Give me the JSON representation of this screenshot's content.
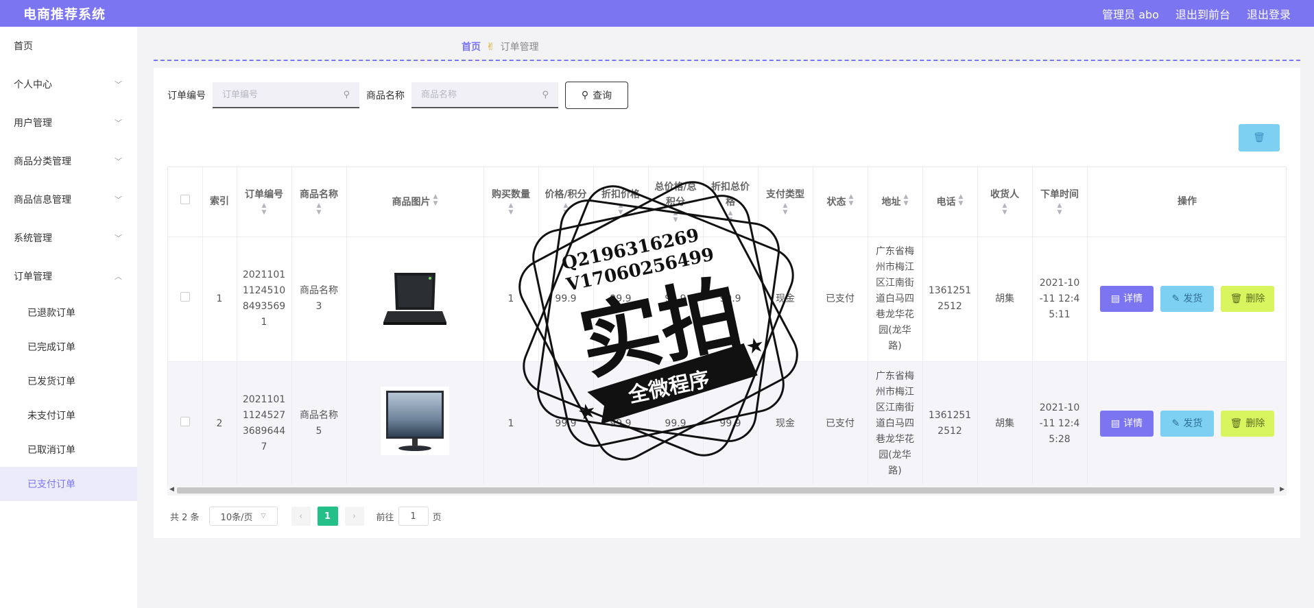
{
  "header": {
    "brand": "电商推荐系统",
    "admin": "管理员 abo",
    "to_front": "退出到前台",
    "logout": "退出登录"
  },
  "sidebar": {
    "items": [
      {
        "label": "首页"
      },
      {
        "label": "个人中心"
      },
      {
        "label": "用户管理"
      },
      {
        "label": "商品分类管理"
      },
      {
        "label": "商品信息管理"
      },
      {
        "label": "系统管理"
      },
      {
        "label": "订单管理"
      }
    ],
    "order_sub": [
      {
        "label": "已退款订单"
      },
      {
        "label": "已完成订单"
      },
      {
        "label": "已发货订单"
      },
      {
        "label": "未支付订单"
      },
      {
        "label": "已取消订单"
      },
      {
        "label": "已支付订单"
      }
    ]
  },
  "breadcrumb": {
    "home": "首页",
    "current": "订单管理"
  },
  "search": {
    "order_label": "订单编号",
    "order_placeholder": "订单编号",
    "product_label": "商品名称",
    "product_placeholder": "商品名称",
    "query": "查询"
  },
  "table": {
    "headers": {
      "index": "索引",
      "order_no": "订单编号",
      "product_name": "商品名称",
      "product_img": "商品图片",
      "qty": "购买数量",
      "price": "价格/积分",
      "discount_price": "折扣价格",
      "total": "总价格/总积分",
      "discount_total": "折扣总价格",
      "pay_type": "支付类型",
      "status": "状态",
      "address": "地址",
      "phone": "电话",
      "receiver": "收货人",
      "order_time": "下单时间",
      "ops": "操作"
    },
    "rows": [
      {
        "index": "1",
        "order_no": "20211011124510849356 91",
        "order_no_display": "2021101\n1124510\n8493569\n1",
        "product_name": "商品名称\n3",
        "qty": "1",
        "price": "99.9",
        "discount_price": "99.9",
        "total": "99.9",
        "discount_total": "99.9",
        "pay_type": "现金",
        "status": "已支付",
        "address": "广东省梅\n州市梅江\n区江南街\n道白马四\n巷龙华花\n园(龙华\n路)",
        "phone": "1361251\n2512",
        "receiver": "胡集",
        "order_time": "2021-10\n-11 12:4\n5:11"
      },
      {
        "index": "2",
        "order_no": "20211011124527368964 47",
        "order_no_display": "2021101\n1124527\n3689644\n7",
        "product_name": "商品名称\n5",
        "qty": "1",
        "price": "99.9",
        "discount_price": "99.9",
        "total": "99.9",
        "discount_total": "99.9",
        "pay_type": "现金",
        "status": "已支付",
        "address": "广东省梅\n州市梅江\n区江南街\n道白马四\n巷龙华花\n园(龙华\n路)",
        "phone": "1361251\n2512",
        "receiver": "胡集",
        "order_time": "2021-10\n-11 12:4\n5:28"
      }
    ],
    "buttons": {
      "detail": "详情",
      "ship": "发货",
      "delete": "删除"
    }
  },
  "pager": {
    "total": "共 2 条",
    "size": "10条/页",
    "page": "1",
    "goto": "前往",
    "goto_value": "1",
    "page_unit": "页"
  },
  "watermark": {
    "line1": "Q2196316269",
    "line2": "V17060256499",
    "big": "实拍",
    "banner": "全微程序"
  },
  "colors": {
    "primary": "#7c75f2",
    "ship": "#7ed0f3",
    "delete": "#d8f560",
    "page_active": "#25c08a"
  }
}
